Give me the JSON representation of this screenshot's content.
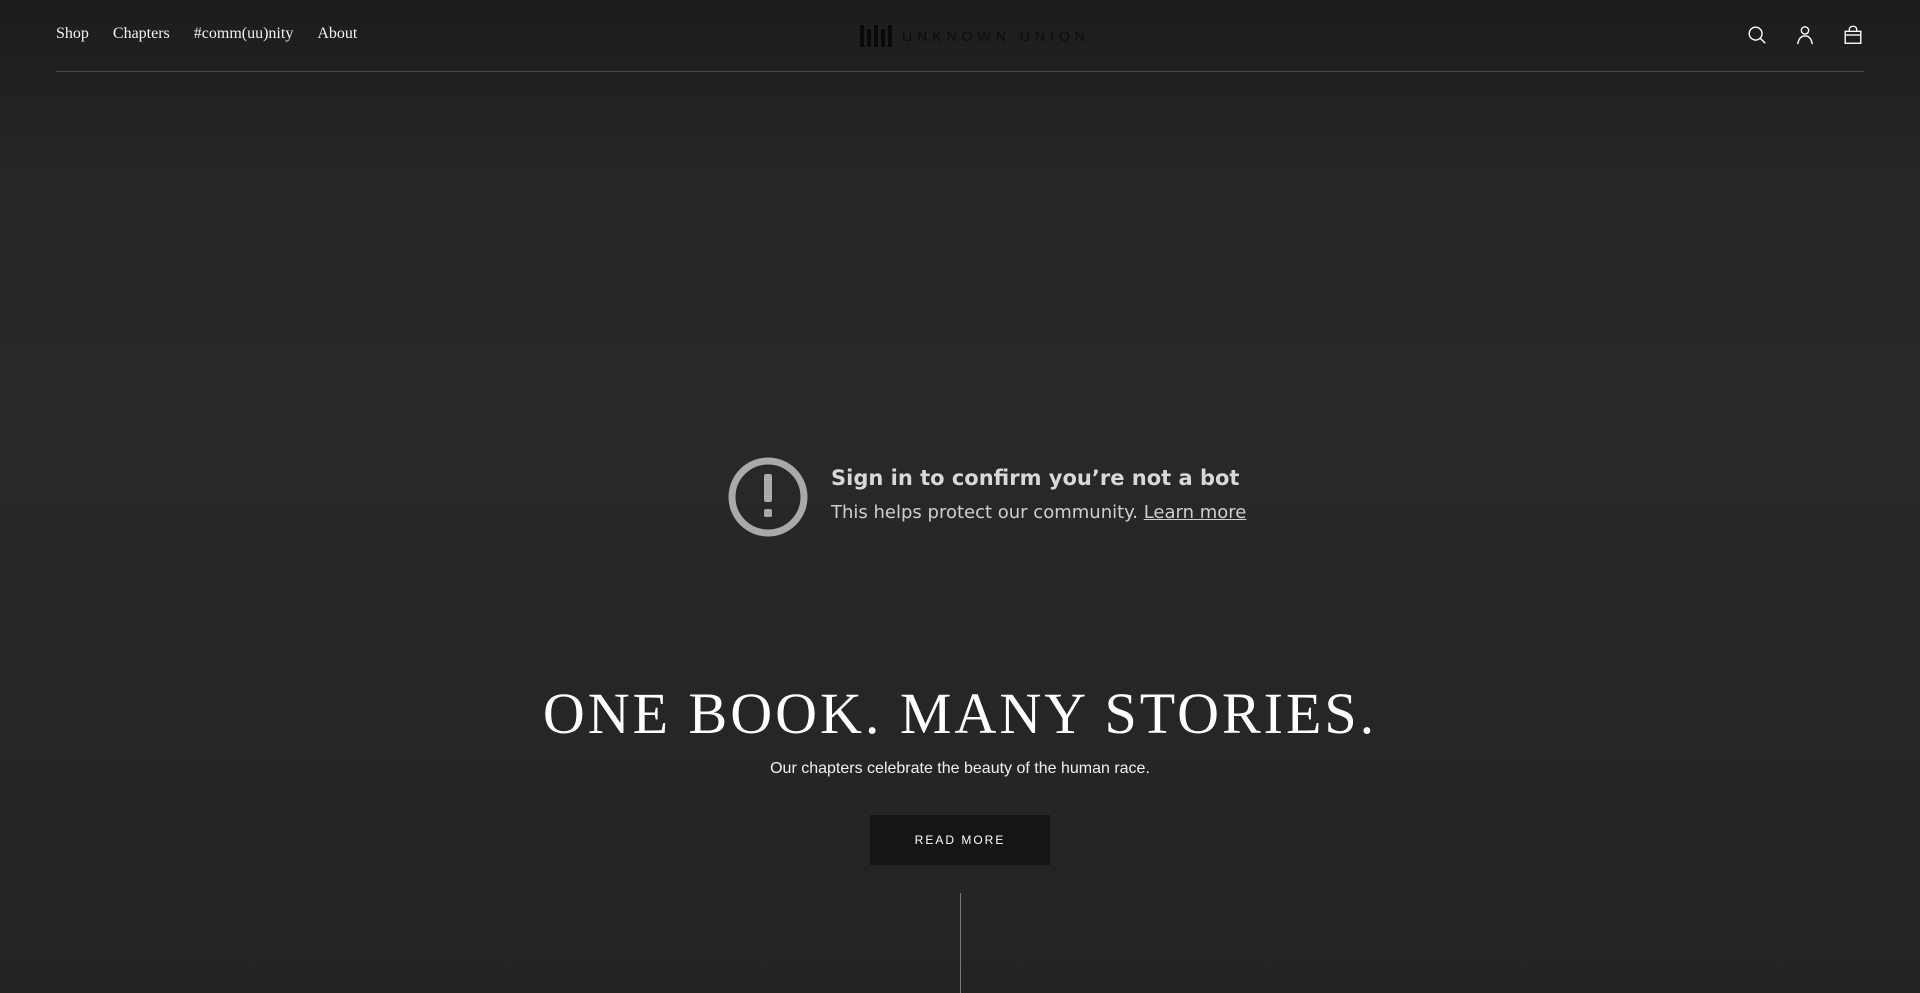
{
  "nav": {
    "items": [
      {
        "label": "Shop"
      },
      {
        "label": "Chapters"
      },
      {
        "label": "#comm(uu)nity"
      },
      {
        "label": "About"
      }
    ]
  },
  "logo": {
    "text": "UNKNOWN UNION"
  },
  "header_icons": [
    "search-icon",
    "account-icon",
    "cart-icon"
  ],
  "notice": {
    "title": "Sign in to confirm you’re not a bot",
    "subtitle": "This helps protect our community.",
    "link_label": "Learn more",
    "icon": "exclamation-circle-icon"
  },
  "hero": {
    "title": "ONE BOOK. MANY STORIES.",
    "subtitle": "Our chapters celebrate the beauty of the human race.",
    "button_label": "READ MORE"
  },
  "colors": {
    "background": "#232323",
    "button": "#151515",
    "notice_icon": "#a9a9a9"
  }
}
